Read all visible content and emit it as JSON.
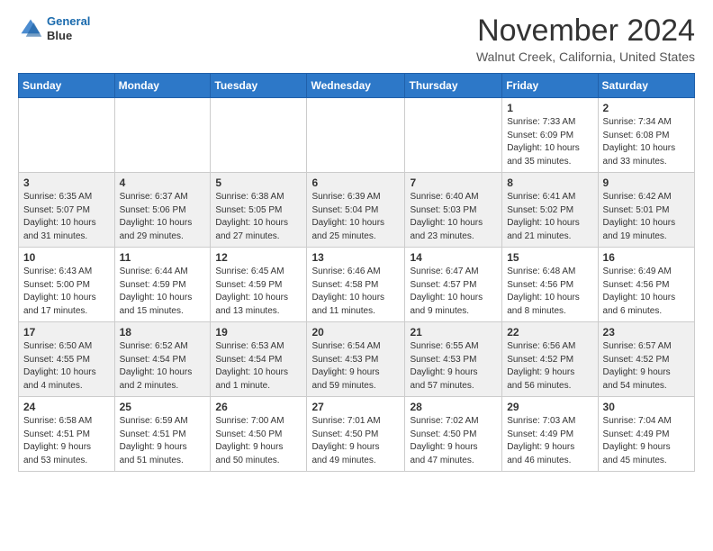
{
  "header": {
    "logo_line1": "General",
    "logo_line2": "Blue",
    "month_title": "November 2024",
    "location": "Walnut Creek, California, United States"
  },
  "days_of_week": [
    "Sunday",
    "Monday",
    "Tuesday",
    "Wednesday",
    "Thursday",
    "Friday",
    "Saturday"
  ],
  "weeks": [
    [
      {
        "day": "",
        "info": ""
      },
      {
        "day": "",
        "info": ""
      },
      {
        "day": "",
        "info": ""
      },
      {
        "day": "",
        "info": ""
      },
      {
        "day": "",
        "info": ""
      },
      {
        "day": "1",
        "info": "Sunrise: 7:33 AM\nSunset: 6:09 PM\nDaylight: 10 hours\nand 35 minutes."
      },
      {
        "day": "2",
        "info": "Sunrise: 7:34 AM\nSunset: 6:08 PM\nDaylight: 10 hours\nand 33 minutes."
      }
    ],
    [
      {
        "day": "3",
        "info": "Sunrise: 6:35 AM\nSunset: 5:07 PM\nDaylight: 10 hours\nand 31 minutes."
      },
      {
        "day": "4",
        "info": "Sunrise: 6:37 AM\nSunset: 5:06 PM\nDaylight: 10 hours\nand 29 minutes."
      },
      {
        "day": "5",
        "info": "Sunrise: 6:38 AM\nSunset: 5:05 PM\nDaylight: 10 hours\nand 27 minutes."
      },
      {
        "day": "6",
        "info": "Sunrise: 6:39 AM\nSunset: 5:04 PM\nDaylight: 10 hours\nand 25 minutes."
      },
      {
        "day": "7",
        "info": "Sunrise: 6:40 AM\nSunset: 5:03 PM\nDaylight: 10 hours\nand 23 minutes."
      },
      {
        "day": "8",
        "info": "Sunrise: 6:41 AM\nSunset: 5:02 PM\nDaylight: 10 hours\nand 21 minutes."
      },
      {
        "day": "9",
        "info": "Sunrise: 6:42 AM\nSunset: 5:01 PM\nDaylight: 10 hours\nand 19 minutes."
      }
    ],
    [
      {
        "day": "10",
        "info": "Sunrise: 6:43 AM\nSunset: 5:00 PM\nDaylight: 10 hours\nand 17 minutes."
      },
      {
        "day": "11",
        "info": "Sunrise: 6:44 AM\nSunset: 4:59 PM\nDaylight: 10 hours\nand 15 minutes."
      },
      {
        "day": "12",
        "info": "Sunrise: 6:45 AM\nSunset: 4:59 PM\nDaylight: 10 hours\nand 13 minutes."
      },
      {
        "day": "13",
        "info": "Sunrise: 6:46 AM\nSunset: 4:58 PM\nDaylight: 10 hours\nand 11 minutes."
      },
      {
        "day": "14",
        "info": "Sunrise: 6:47 AM\nSunset: 4:57 PM\nDaylight: 10 hours\nand 9 minutes."
      },
      {
        "day": "15",
        "info": "Sunrise: 6:48 AM\nSunset: 4:56 PM\nDaylight: 10 hours\nand 8 minutes."
      },
      {
        "day": "16",
        "info": "Sunrise: 6:49 AM\nSunset: 4:56 PM\nDaylight: 10 hours\nand 6 minutes."
      }
    ],
    [
      {
        "day": "17",
        "info": "Sunrise: 6:50 AM\nSunset: 4:55 PM\nDaylight: 10 hours\nand 4 minutes."
      },
      {
        "day": "18",
        "info": "Sunrise: 6:52 AM\nSunset: 4:54 PM\nDaylight: 10 hours\nand 2 minutes."
      },
      {
        "day": "19",
        "info": "Sunrise: 6:53 AM\nSunset: 4:54 PM\nDaylight: 10 hours\nand 1 minute."
      },
      {
        "day": "20",
        "info": "Sunrise: 6:54 AM\nSunset: 4:53 PM\nDaylight: 9 hours\nand 59 minutes."
      },
      {
        "day": "21",
        "info": "Sunrise: 6:55 AM\nSunset: 4:53 PM\nDaylight: 9 hours\nand 57 minutes."
      },
      {
        "day": "22",
        "info": "Sunrise: 6:56 AM\nSunset: 4:52 PM\nDaylight: 9 hours\nand 56 minutes."
      },
      {
        "day": "23",
        "info": "Sunrise: 6:57 AM\nSunset: 4:52 PM\nDaylight: 9 hours\nand 54 minutes."
      }
    ],
    [
      {
        "day": "24",
        "info": "Sunrise: 6:58 AM\nSunset: 4:51 PM\nDaylight: 9 hours\nand 53 minutes."
      },
      {
        "day": "25",
        "info": "Sunrise: 6:59 AM\nSunset: 4:51 PM\nDaylight: 9 hours\nand 51 minutes."
      },
      {
        "day": "26",
        "info": "Sunrise: 7:00 AM\nSunset: 4:50 PM\nDaylight: 9 hours\nand 50 minutes."
      },
      {
        "day": "27",
        "info": "Sunrise: 7:01 AM\nSunset: 4:50 PM\nDaylight: 9 hours\nand 49 minutes."
      },
      {
        "day": "28",
        "info": "Sunrise: 7:02 AM\nSunset: 4:50 PM\nDaylight: 9 hours\nand 47 minutes."
      },
      {
        "day": "29",
        "info": "Sunrise: 7:03 AM\nSunset: 4:49 PM\nDaylight: 9 hours\nand 46 minutes."
      },
      {
        "day": "30",
        "info": "Sunrise: 7:04 AM\nSunset: 4:49 PM\nDaylight: 9 hours\nand 45 minutes."
      }
    ]
  ]
}
